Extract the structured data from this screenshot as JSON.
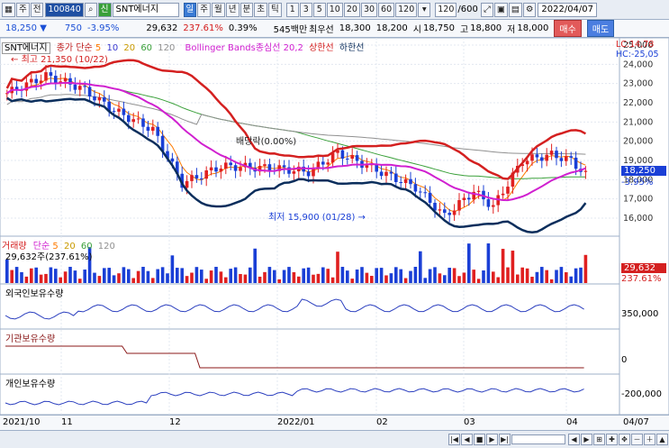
{
  "toolbar": {
    "code_label": "주",
    "prefix": "전",
    "code": "100840",
    "market_badge": "신",
    "name": "SNT에너지",
    "periods": [
      "일",
      "주",
      "월",
      "년",
      "분",
      "초",
      "틱"
    ],
    "active_period": "일",
    "intervals": [
      "1",
      "3",
      "5",
      "10",
      "20",
      "30",
      "60",
      "120"
    ],
    "count": "120",
    "total": "/600",
    "date": "2022/04/07"
  },
  "pricebar": {
    "price": "18,250",
    "change": "750",
    "change_pct": "-3.95%",
    "volume": "29,632",
    "volume_ratio": "237.61%",
    "turnover": "0.39%",
    "amount": "545백만",
    "prior_label": "최우선",
    "ask": "18,300",
    "bid": "18,200",
    "open_label": "시",
    "open": "18,750",
    "high_label": "고",
    "high": "18,800",
    "low_label": "저",
    "low": "18,000",
    "buy": "매수",
    "sell": "매도"
  },
  "price_legend": {
    "name": "SNT에너지",
    "ma_label": "종가 단순",
    "ma5": "5",
    "ma10": "10",
    "ma20": "20",
    "ma60": "60",
    "ma120": "120",
    "bb_label": "Bollinger Bands종심선 20,2",
    "bb_upper": "상한선",
    "bb_lower": "하한선",
    "lc": "LC:14,78",
    "hc": "HC:-25,05",
    "max_label": "최고 21,350 (10/22)",
    "min_label": "최저 15,900 (01/28)",
    "dividend_label": "배당락(0.00%)",
    "current_price": "18,250",
    "current_pct": "-3.95%"
  },
  "price_axis": [
    "25,000",
    "24,000",
    "23,000",
    "22,000",
    "21,000",
    "20,000",
    "19,000",
    "18,000",
    "17,000",
    "16,000"
  ],
  "volume_legend": {
    "title": "거래량",
    "ma_label": "단순",
    "ma5": "5",
    "ma20": "20",
    "ma60": "60",
    "ma120": "120",
    "current": "29,632주(237.61%)",
    "axis_value": "29,632",
    "axis_pct": "237.61%"
  },
  "foreign": {
    "title": "외국인보유수량",
    "axis": "350,000"
  },
  "institution": {
    "title": "기관보유수량",
    "axis": "0"
  },
  "individual": {
    "title": "개인보유수량",
    "axis": "-200,000"
  },
  "x_axis": [
    "2021/10",
    "11",
    "12",
    "2022/01",
    "02",
    "03",
    "04",
    "04/07"
  ],
  "colors": {
    "bb_upper": "#d42020",
    "bb_lower": "#0b2e5c",
    "bb_mid": "#d020d0",
    "ma5": "#ff7a00",
    "ma20": "#c99a00",
    "ma60": "#3aa03a",
    "ma120": "#909090",
    "up": "#e02020",
    "down": "#1a3fd6"
  }
}
